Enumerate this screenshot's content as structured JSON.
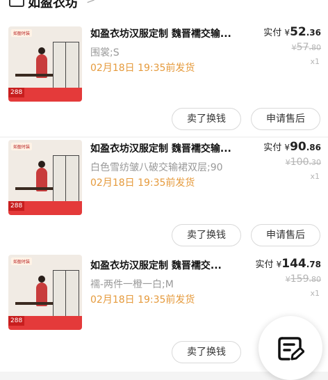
{
  "shop": {
    "name": "如盈衣坊",
    "chevron": ">"
  },
  "orders": [
    {
      "title": "如盈衣坊汉服定制 魏晋襦交输...",
      "spec": "围裳;S",
      "ship": "02月18日 19:35前发货",
      "paid_label": "实付",
      "paid_currency": "¥",
      "paid_int": "52",
      "paid_dec": ".36",
      "orig_currency": "¥",
      "orig_int": "57",
      "orig_dec": ".80",
      "qty": "x1",
      "thumb_tag": "如盈时装",
      "thumb_price": "288",
      "btn_sell": "卖了换钱",
      "btn_after": "申请售后"
    },
    {
      "title": "如盈衣坊汉服定制 魏晋襦交输...",
      "spec": "白色雪纺皱八破交输裙双层;90",
      "ship": "02月18日 19:35前发货",
      "paid_label": "实付",
      "paid_currency": "¥",
      "paid_int": "90",
      "paid_dec": ".86",
      "orig_currency": "¥",
      "orig_int": "100",
      "orig_dec": ".30",
      "qty": "x1",
      "thumb_tag": "如盈时装",
      "thumb_price": "288",
      "btn_sell": "卖了换钱",
      "btn_after": "申请售后"
    },
    {
      "title": "如盈衣坊汉服定制 魏晋襦交...",
      "spec": "襦-两件一橙一白;M",
      "ship": "02月18日 19:35前发货",
      "paid_label": "实付",
      "paid_currency": "¥",
      "paid_int": "144",
      "paid_dec": ".78",
      "orig_currency": "¥",
      "orig_int": "159",
      "orig_dec": ".80",
      "qty": "x1",
      "thumb_tag": "如盈时装",
      "thumb_price": "288",
      "btn_sell": "卖了换钱",
      "btn_after": "申请售后"
    }
  ],
  "fab": {
    "icon": "feedback-edit-icon"
  },
  "colors": {
    "ship": "#e59a3c",
    "banner": "#e43a3a"
  }
}
